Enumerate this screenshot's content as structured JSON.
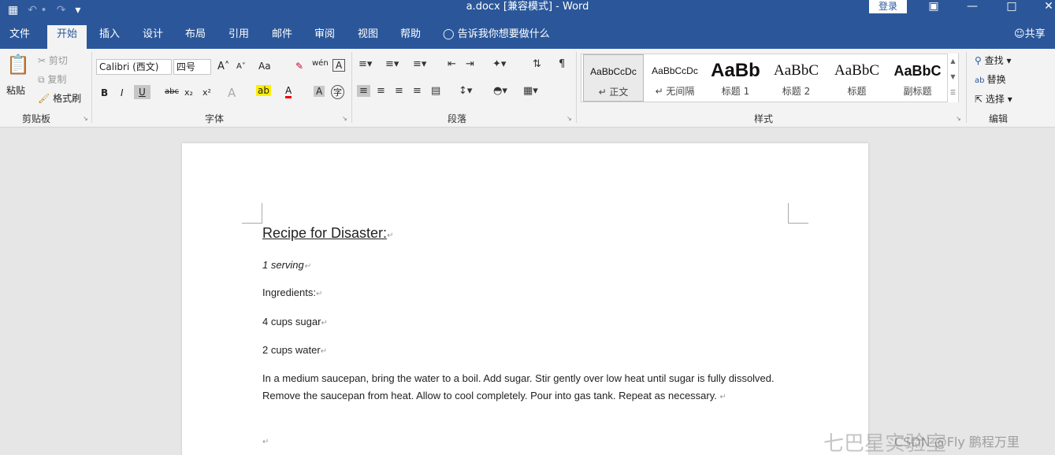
{
  "titlebar": {
    "save_glyph": "🖥",
    "undo_glyph": "↶ •",
    "redo_glyph": "↷",
    "more_glyph": "▾",
    "title": "a.docx [兼容模式] - Word",
    "login": "登录",
    "ribbon_opts_glyph": "▣",
    "minimize_glyph": "—",
    "maximize_glyph": "□",
    "close_glyph": "✕"
  },
  "tabs": [
    "文件",
    "开始",
    "插入",
    "设计",
    "布局",
    "引用",
    "邮件",
    "审阅",
    "视图",
    "帮助"
  ],
  "tell_me": "告诉我你想要做什么",
  "share": "共享",
  "clipboard": {
    "paste": "粘贴",
    "cut": "剪切",
    "copy": "复制",
    "format_painter": "格式刷",
    "label": "剪贴板"
  },
  "font": {
    "name": "Calibri (西文)",
    "size": "四号",
    "label": "字体",
    "grow": "A˄",
    "shrink": "A˅",
    "case": "Aa",
    "bold": "B",
    "italic": "I",
    "underline": "U",
    "strike": "abc",
    "sub": "x₂",
    "sup": "x²",
    "effects": "A",
    "highlight": "ab",
    "color": "A",
    "shade": "A",
    "enclose": "字",
    "phonetic": "wén",
    "border_char": "A"
  },
  "paragraph": {
    "label": "段落"
  },
  "styles": {
    "label": "样式",
    "items": [
      {
        "preview": "AaBbCcDc",
        "name": "↵ 正文"
      },
      {
        "preview": "AaBbCcDc",
        "name": "↵ 无间隔"
      },
      {
        "preview": "AaBb",
        "name": "标题 1"
      },
      {
        "preview": "AaBbC",
        "name": "标题 2"
      },
      {
        "preview": "AaBbC",
        "name": "标题"
      },
      {
        "preview": "AaBbC",
        "name": "副标题"
      }
    ]
  },
  "editing": {
    "find": "查找",
    "replace": "替换",
    "select": "选择",
    "label": "编辑"
  },
  "document": {
    "title": "Recipe for Disaster:",
    "serving": "1 serving",
    "ingredients": "Ingredients:",
    "item1": "4 cups sugar",
    "item2": "2 cups water",
    "instructions": "In a medium saucepan, bring the water to a boil. Add sugar. Stir gently over low heat until sugar is fully dissolved. Remove  the  saucepan from heat.  Allow to cool completely. Pour into gas tank. Repeat as necessary.",
    "para_mark": "↵"
  },
  "watermark": {
    "big": "七巴星实验室",
    "small": "CSDN @Fly 鹏程万里"
  }
}
